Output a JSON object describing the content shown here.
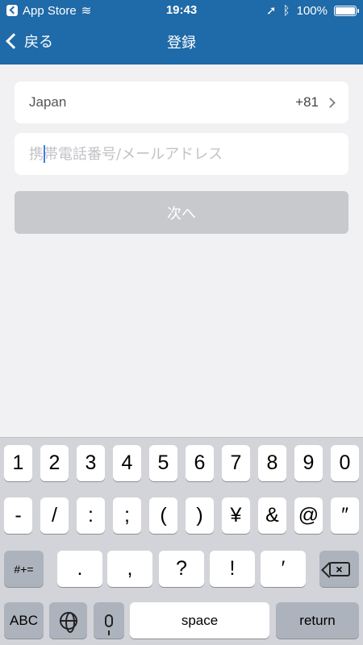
{
  "status_bar": {
    "back_app": "App Store",
    "time": "19:43",
    "battery": "100%"
  },
  "nav": {
    "back_label": "戻る",
    "title": "登録"
  },
  "form": {
    "country_name": "Japan",
    "country_code": "+81",
    "phone_placeholder": "携帯電話番号/メールアドレス",
    "phone_value": "",
    "next_label": "次へ"
  },
  "keyboard": {
    "row1": [
      "1",
      "2",
      "3",
      "4",
      "5",
      "6",
      "7",
      "8",
      "9",
      "0"
    ],
    "row2": [
      "-",
      "/",
      ":",
      ";",
      "(",
      ")",
      "¥",
      "&",
      "@",
      "″"
    ],
    "row3_left": "#+=",
    "row3": [
      ".",
      ",",
      "?",
      "!",
      "′"
    ],
    "abc": "ABC",
    "space": "space",
    "return": "return"
  }
}
